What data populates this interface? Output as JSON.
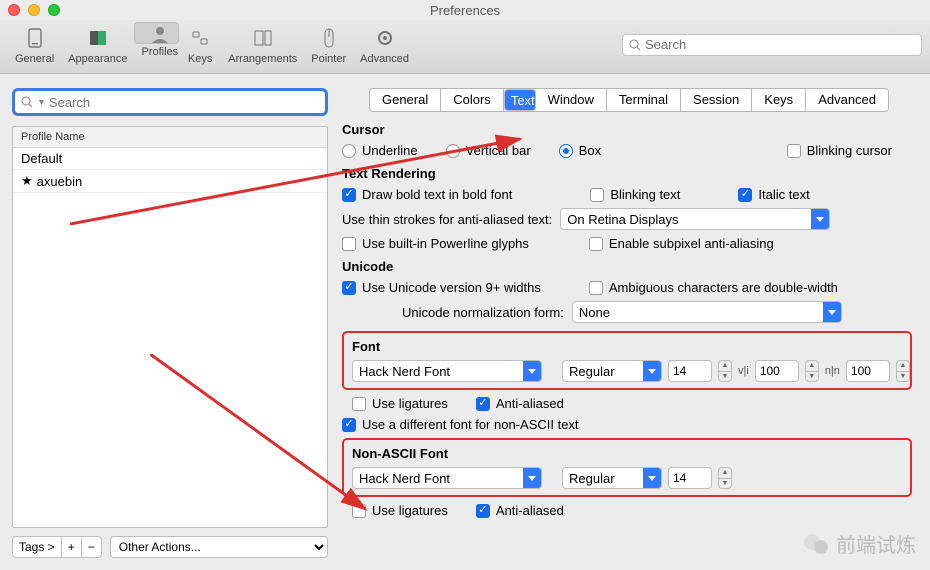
{
  "window": {
    "title": "Preferences"
  },
  "toolbar": {
    "items": [
      "General",
      "Appearance",
      "Profiles",
      "Keys",
      "Arrangements",
      "Pointer",
      "Advanced"
    ],
    "selected": "Profiles",
    "search_placeholder": "Search"
  },
  "sidebar": {
    "search_placeholder": "Search",
    "header": "Profile Name",
    "profiles": [
      "Default",
      "axuebin"
    ],
    "tags_label": "Tags >",
    "plus": "+",
    "minus": "−",
    "other_actions": "Other Actions..."
  },
  "tabs": {
    "items": [
      "General",
      "Colors",
      "Text",
      "Window",
      "Terminal",
      "Session",
      "Keys",
      "Advanced"
    ],
    "selected": "Text"
  },
  "cursor": {
    "title": "Cursor",
    "underline": "Underline",
    "vertical": "Vertical bar",
    "box": "Box",
    "selected": "Box",
    "blinking": "Blinking cursor"
  },
  "text_rendering": {
    "title": "Text Rendering",
    "bold": "Draw bold text in bold font",
    "blinking": "Blinking text",
    "italic": "Italic text",
    "thin_label": "Use thin strokes for anti-aliased text:",
    "thin_value": "On Retina Displays",
    "powerline": "Use built-in Powerline glyphs",
    "subpixel": "Enable subpixel anti-aliasing"
  },
  "unicode": {
    "title": "Unicode",
    "widths": "Use Unicode version 9+ widths",
    "ambiguous": "Ambiguous characters are double-width",
    "norm_label": "Unicode normalization form:",
    "norm_value": "None"
  },
  "font": {
    "title": "Font",
    "family": "Hack Nerd Font",
    "weight": "Regular",
    "size": "14",
    "vspace_label": "v|i",
    "vspace": "100",
    "hspace_label": "n|n",
    "hspace": "100",
    "ligatures": "Use ligatures",
    "antialiased": "Anti-aliased",
    "different": "Use a different font for non-ASCII text"
  },
  "nonascii": {
    "title": "Non-ASCII Font",
    "family": "Hack Nerd Font",
    "weight": "Regular",
    "size": "14",
    "ligatures": "Use ligatures",
    "antialiased": "Anti-aliased"
  },
  "watermark": "前端试炼"
}
